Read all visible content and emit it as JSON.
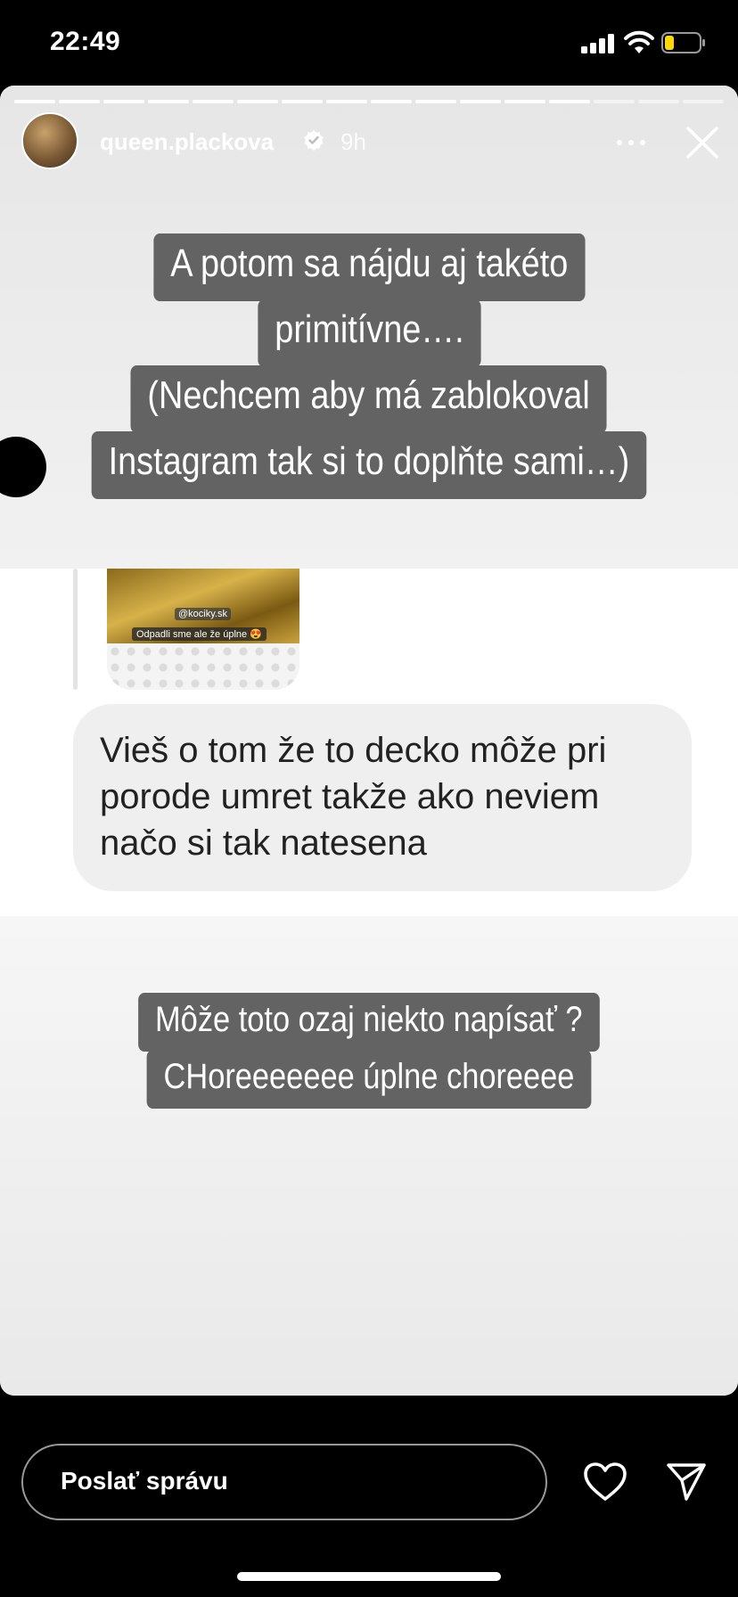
{
  "status_bar": {
    "time": "22:49",
    "icons": [
      "cellular-signal-icon",
      "wifi-icon",
      "battery-low-icon"
    ],
    "battery_color": "#ffd60a"
  },
  "story": {
    "progress_segments": 16,
    "progress_done": 13,
    "username": "queen.plackova",
    "verified_icon": "verified-badge-icon",
    "time_ago": "9h",
    "captions_top": [
      "A potom sa nájdu aj takéto",
      "primitívne….",
      "(Nechcem aby má zablokoval",
      "Instagram tak si to doplňte sami…)"
    ],
    "quoted_story": {
      "mention": "@kociky.sk",
      "caption": "Odpadli sme ale že úplne 😍"
    },
    "message": "Vieš o tom že to decko môže pri\nporode umret takže ako neviem\nnačo si tak natesena",
    "captions_bottom": [
      "Môže toto ozaj niekto napísať ?",
      "CHoreeeeeee úplne choreeee"
    ]
  },
  "reply_bar": {
    "placeholder": "Poslať správu",
    "icons": [
      "heart-icon",
      "send-icon"
    ]
  },
  "colors": {
    "caption_bg": "#636363",
    "bubble_bg": "#efefef",
    "story_bg": "#f3f3f3"
  }
}
